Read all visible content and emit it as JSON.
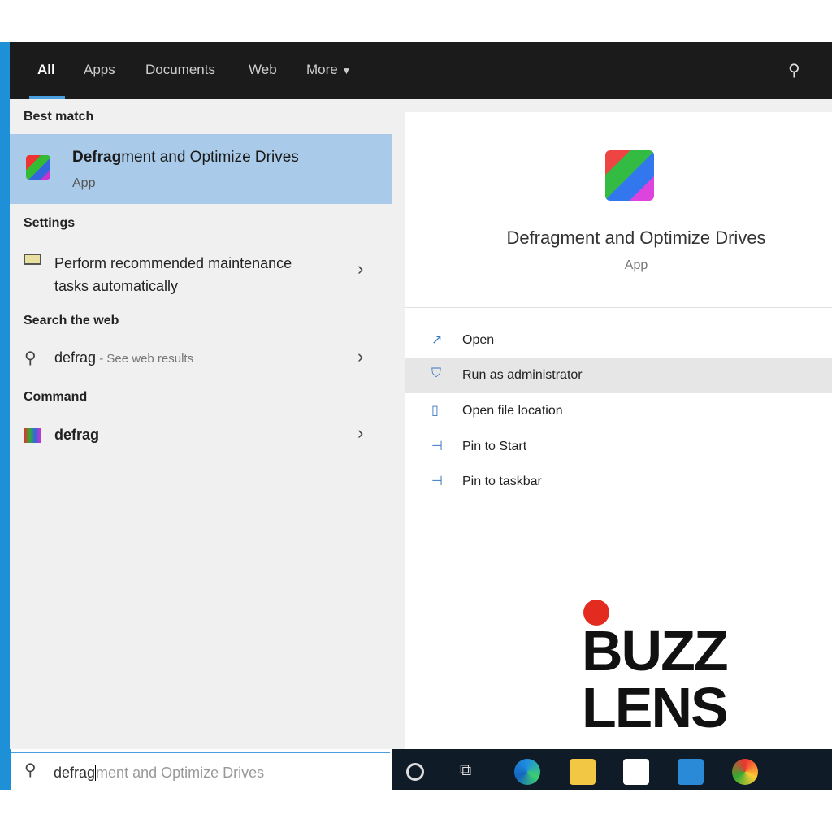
{
  "tabs": [
    {
      "label": "All"
    },
    {
      "label": "Apps"
    },
    {
      "label": "Documents"
    },
    {
      "label": "Web"
    },
    {
      "label": "More"
    }
  ],
  "left": {
    "best_match_heading": "Best match",
    "best_match": {
      "title_bold": "Defrag",
      "title_rest": "ment and Optimize Drives",
      "subtitle": "App"
    },
    "settings_heading": "Settings",
    "settings_item": {
      "line1": "Perform recommended maintenance",
      "line2": "tasks automatically"
    },
    "web_heading": "Search the web",
    "web_item": {
      "query": "defrag",
      "suffix": " - See web results"
    },
    "command_heading": "Command",
    "command_item": "defrag"
  },
  "right": {
    "title": "Defragment and Optimize Drives",
    "subtitle": "App",
    "actions": [
      {
        "label": "Open"
      },
      {
        "label": "Run as administrator"
      },
      {
        "label": "Open file location"
      },
      {
        "label": "Pin to Start"
      },
      {
        "label": "Pin to taskbar"
      }
    ]
  },
  "search": {
    "typed": "defrag",
    "suggestion": "ment and Optimize Drives"
  },
  "logo": {
    "line1": "BUZZ",
    "line2": "LENS"
  },
  "colors": {
    "highlight": "#a9cbe9",
    "accent": "#4a9fe0",
    "topbar": "#1b1b1b",
    "taskbar": "#0f1b26"
  }
}
